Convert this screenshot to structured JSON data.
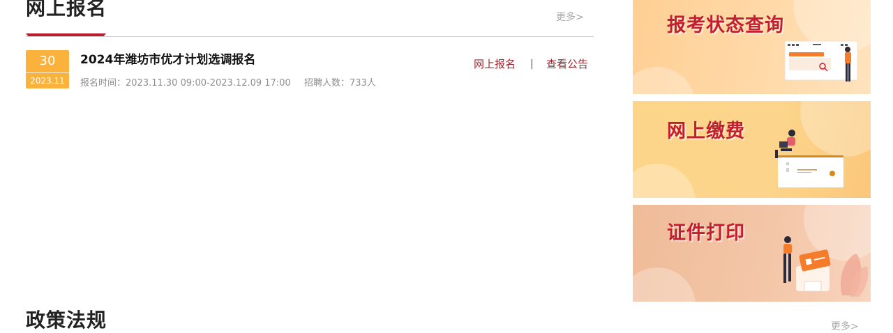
{
  "online_registration": {
    "title": "网上报名",
    "more": "更多>",
    "items": [
      {
        "day": "30",
        "year_month": "2023.11",
        "title": "2024年潍坊市优才计划选调报名",
        "time": "报名时间：2023.11.30 09:00-2023.12.09 17:00",
        "count": "招聘人数：733人",
        "link_apply": "网上报名",
        "separator": "|",
        "link_notice": "查看公告"
      }
    ]
  },
  "policy": {
    "title": "政策法规",
    "more": "更多>"
  },
  "banners": [
    {
      "title": "报考状态查询",
      "icon": "status-query-illustration"
    },
    {
      "title": "网上缴费",
      "icon": "online-payment-illustration"
    },
    {
      "title": "证件打印",
      "icon": "certificate-print-illustration"
    }
  ],
  "colors": {
    "accent_red": "#b51f2e",
    "date_badge": "#fbb23c",
    "link": "#a0262f",
    "banner_title": "#c41e2d"
  }
}
